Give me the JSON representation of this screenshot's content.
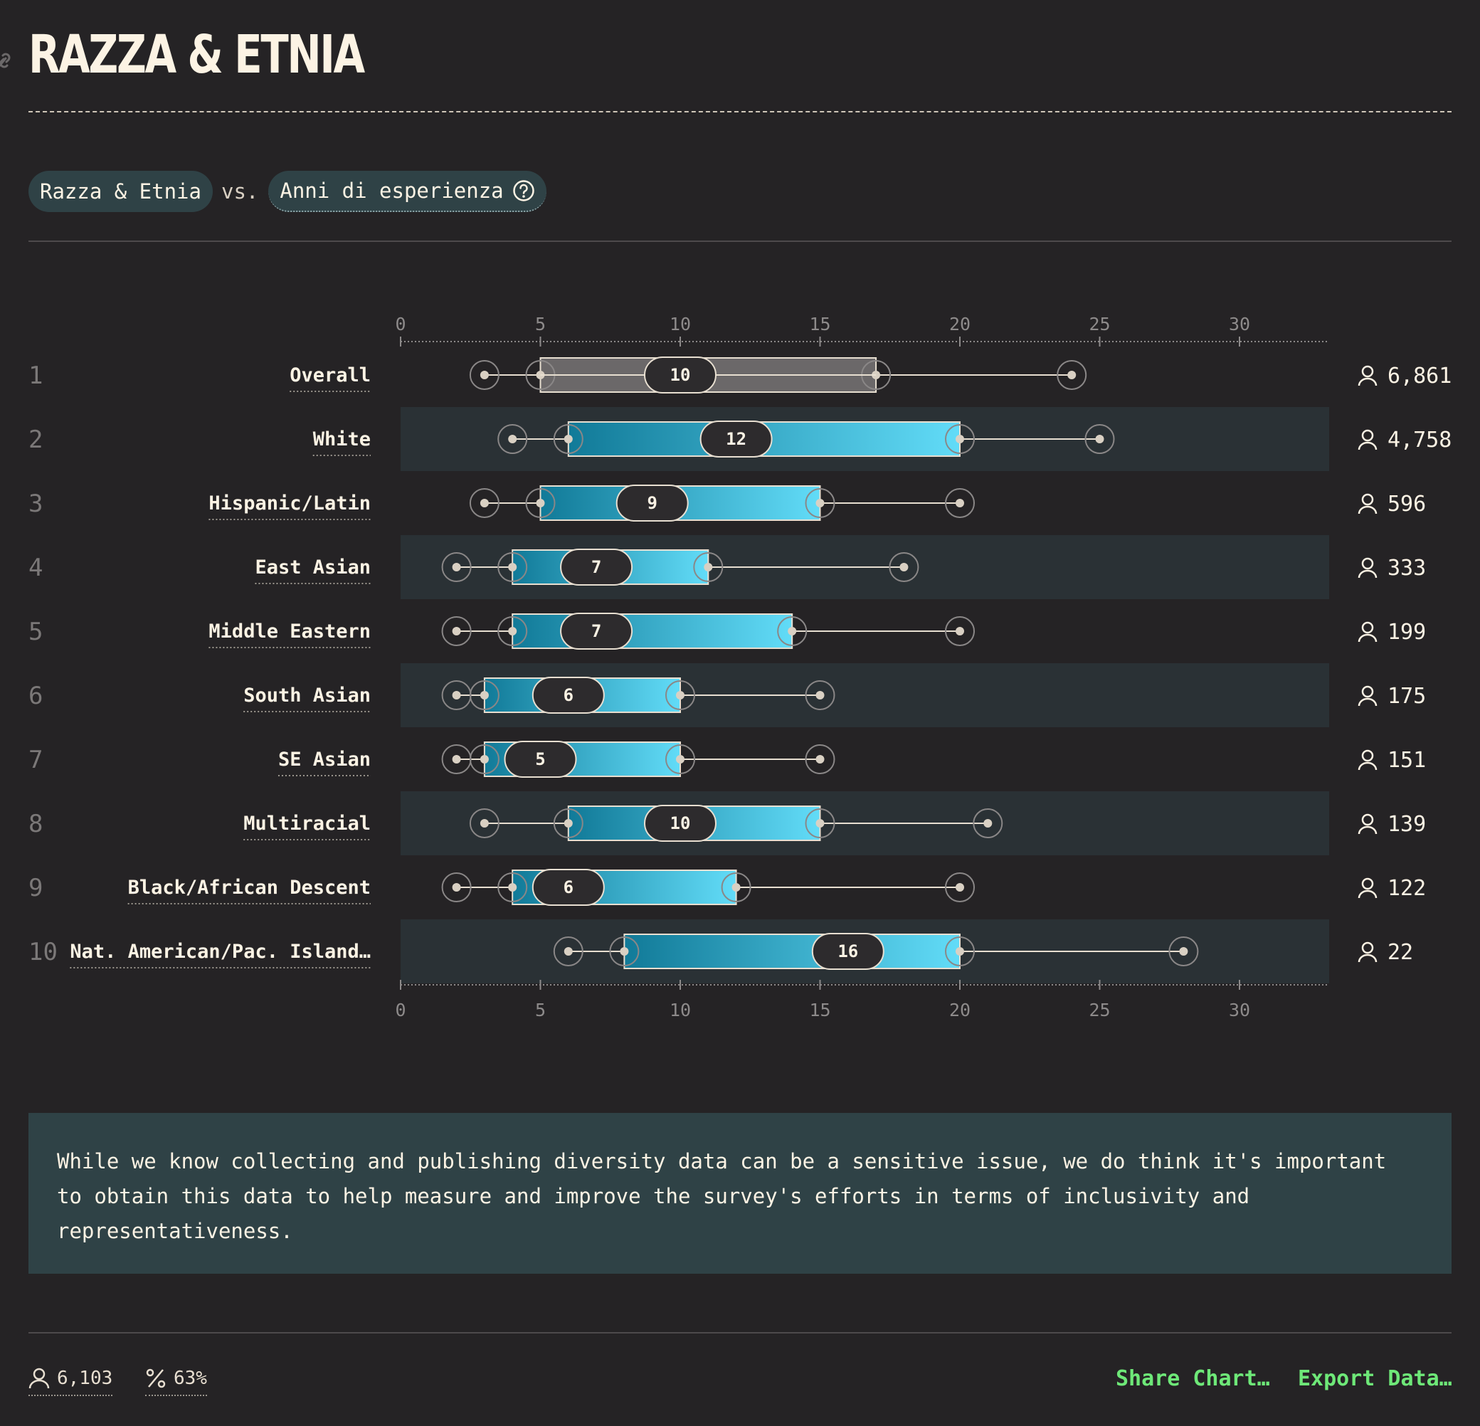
{
  "header": {
    "title": "RAZZA & ETNIA"
  },
  "filters": {
    "primary": "Razza & Etnia",
    "vs": "vs.",
    "secondary": "Anni di esperienza"
  },
  "note": {
    "text": "While we know collecting and publishing diversity data can be a sensitive issue, we do think it's important to obtain this data to help measure and improve the survey's efforts in terms of inclusivity and representativeness."
  },
  "footer": {
    "respondents": "6,103",
    "percentage": "63%",
    "share_label": "Share Chart…",
    "export_label": "Export Data…"
  },
  "colors": {
    "accent_start": "#117a98",
    "accent_end": "#62dcf8",
    "overall_box": "#6b6869",
    "link": "#6ee878",
    "band": "#2a3135"
  },
  "chart_data": {
    "type": "boxplot",
    "title": "",
    "xlabel": "",
    "ylabel": "",
    "xlim": [
      0,
      33
    ],
    "xticks": [
      0,
      5,
      10,
      15,
      20,
      25,
      30
    ],
    "rows": [
      {
        "rank": "1",
        "label": "Overall",
        "p10": 3,
        "p25": 5,
        "median": 10,
        "p75": 17,
        "p90": 24,
        "count": "6,861",
        "overall": true
      },
      {
        "rank": "2",
        "label": "White",
        "p10": 4,
        "p25": 6,
        "median": 12,
        "p75": 20,
        "p90": 25,
        "count": "4,758"
      },
      {
        "rank": "3",
        "label": "Hispanic/Latin",
        "p10": 3,
        "p25": 5,
        "median": 9,
        "p75": 15,
        "p90": 20,
        "count": "596"
      },
      {
        "rank": "4",
        "label": "East Asian",
        "p10": 2,
        "p25": 4,
        "median": 7,
        "p75": 11,
        "p90": 18,
        "count": "333"
      },
      {
        "rank": "5",
        "label": "Middle Eastern",
        "p10": 2,
        "p25": 4,
        "median": 7,
        "p75": 14,
        "p90": 20,
        "count": "199"
      },
      {
        "rank": "6",
        "label": "South Asian",
        "p10": 2,
        "p25": 3,
        "median": 6,
        "p75": 10,
        "p90": 15,
        "count": "175"
      },
      {
        "rank": "7",
        "label": "SE Asian",
        "p10": 2,
        "p25": 3,
        "median": 5,
        "p75": 10,
        "p90": 15,
        "count": "151"
      },
      {
        "rank": "8",
        "label": "Multiracial",
        "p10": 3,
        "p25": 6,
        "median": 10,
        "p75": 15,
        "p90": 21,
        "count": "139"
      },
      {
        "rank": "9",
        "label": "Black/African Descent",
        "p10": 2,
        "p25": 4,
        "median": 6,
        "p75": 12,
        "p90": 20,
        "count": "122"
      },
      {
        "rank": "10",
        "label": "Nat. American/Pac. Island…",
        "p10": 6,
        "p25": 8,
        "median": 16,
        "p75": 20,
        "p90": 28,
        "count": "22"
      }
    ]
  }
}
